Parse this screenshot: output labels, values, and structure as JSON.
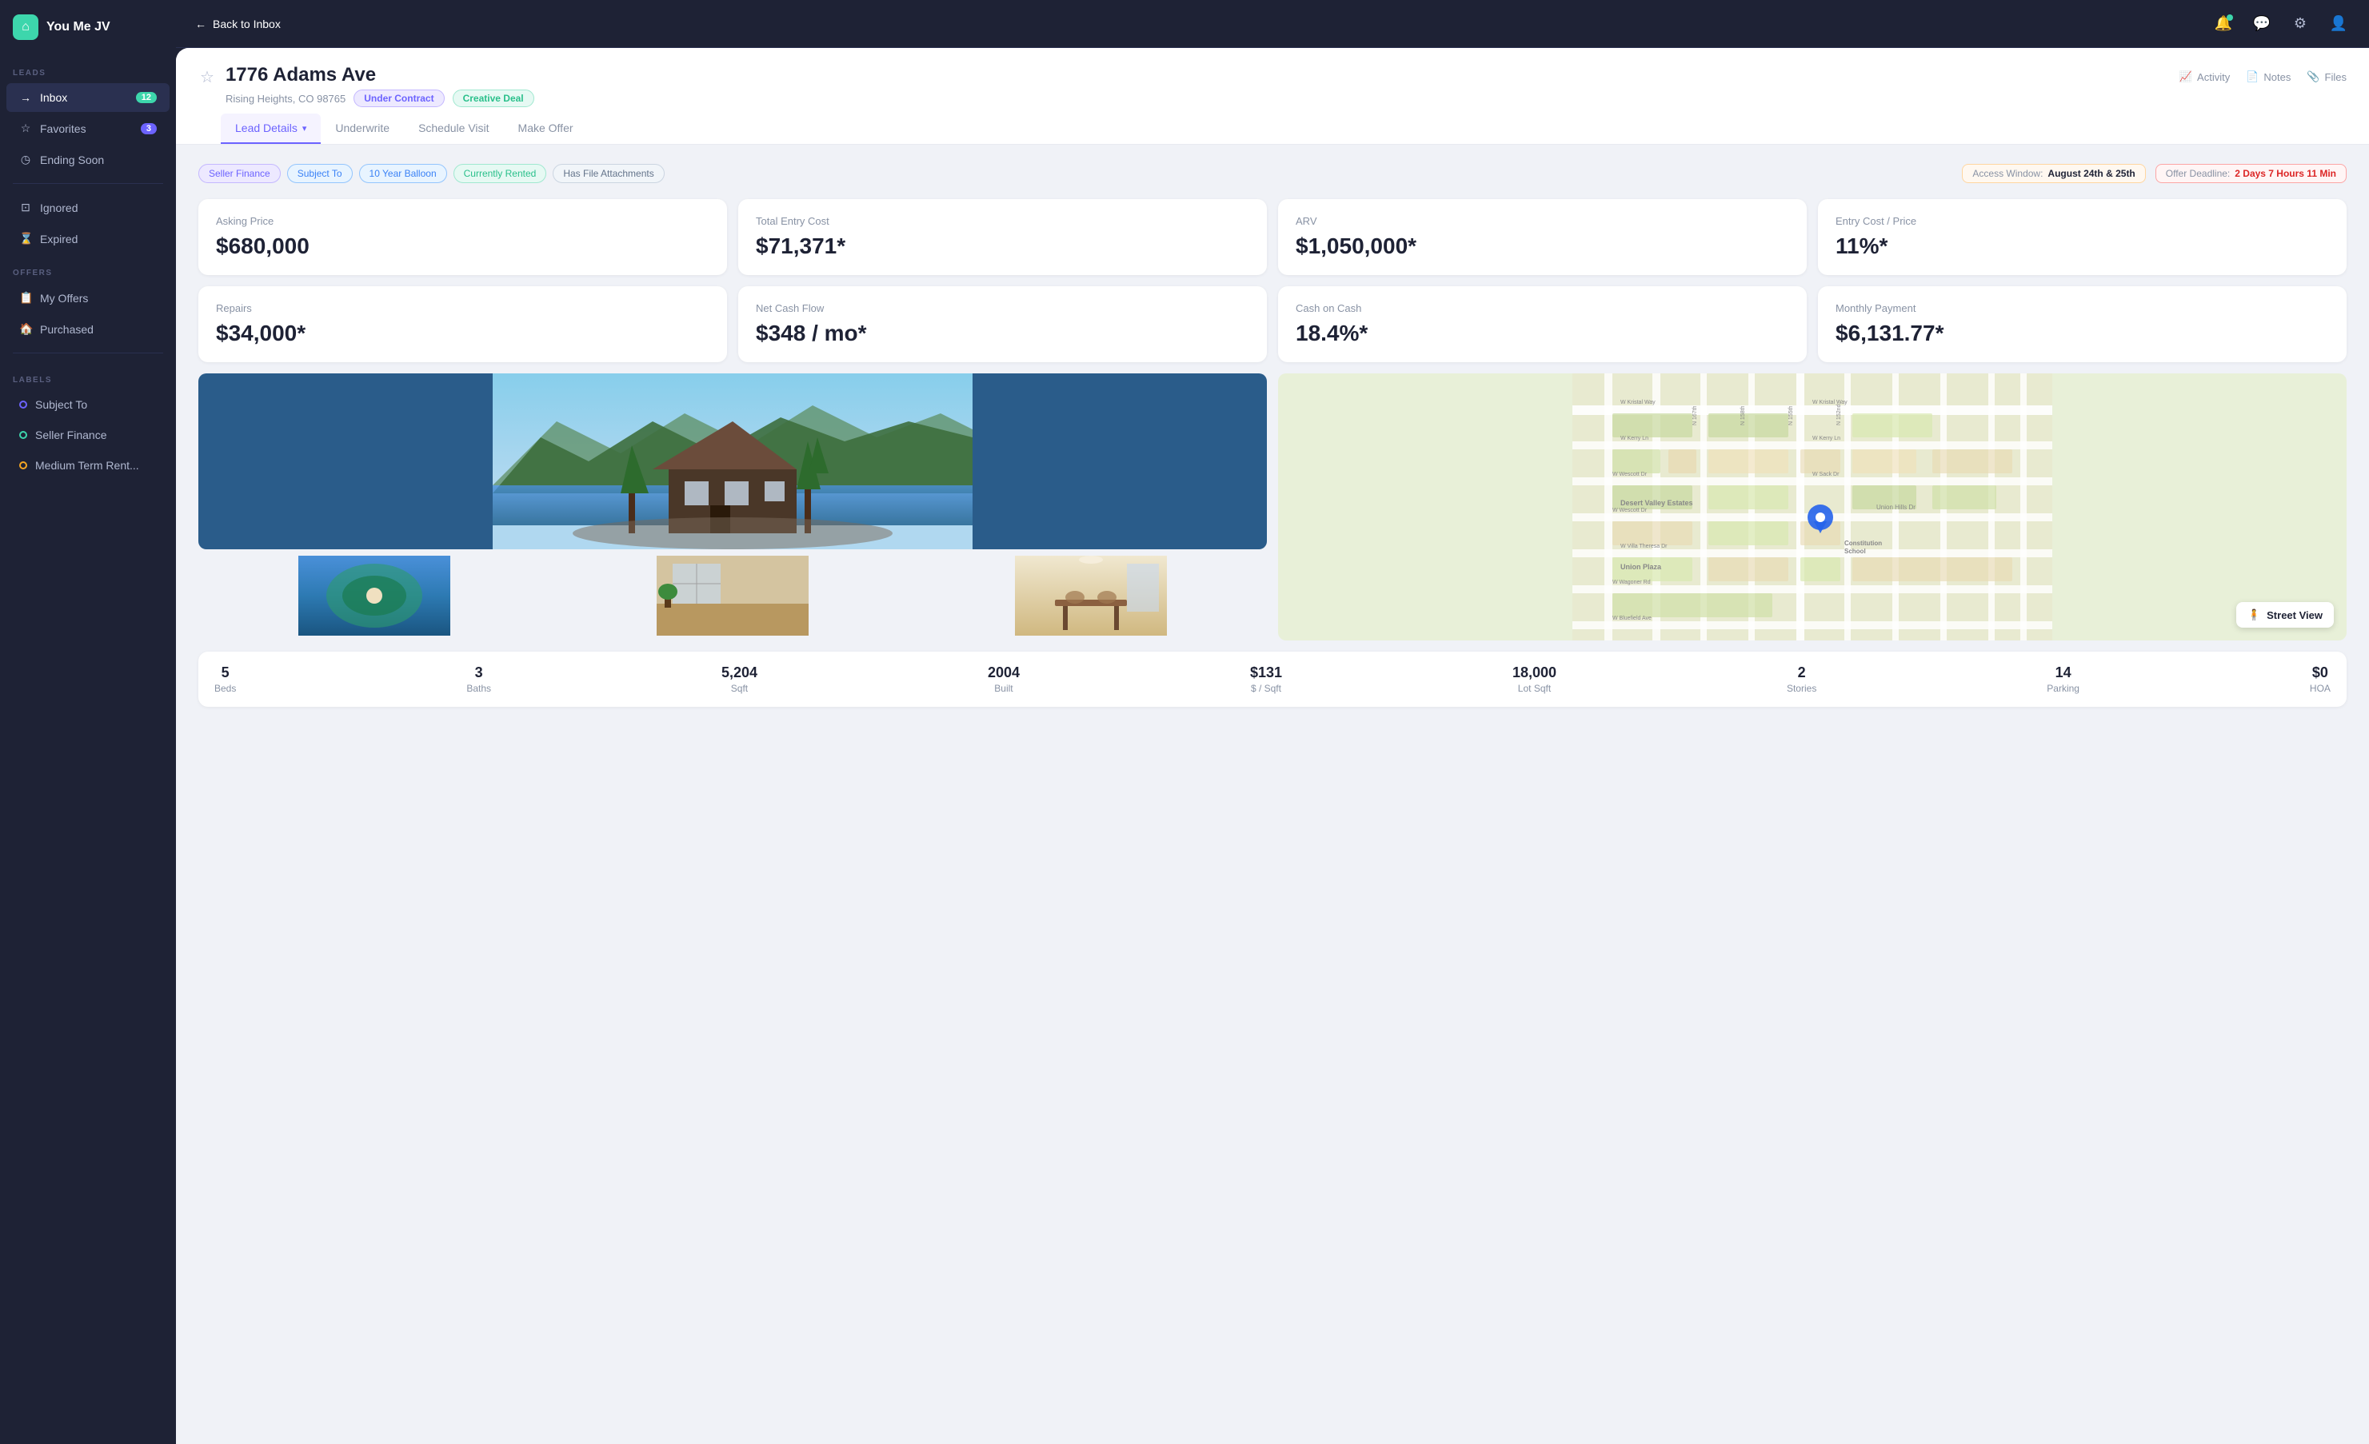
{
  "app": {
    "name": "You Me JV",
    "logo_letter": "⌂"
  },
  "sidebar": {
    "leads_label": "LEADS",
    "offers_label": "OFFERS",
    "labels_label": "LABELS",
    "items": [
      {
        "id": "inbox",
        "label": "Inbox",
        "icon": "→",
        "badge": "12",
        "active": true
      },
      {
        "id": "favorites",
        "label": "Favorites",
        "icon": "☆",
        "badge": "3",
        "badge_type": "blue",
        "active": false
      },
      {
        "id": "ending-soon",
        "label": "Ending Soon",
        "icon": "◷",
        "active": false
      }
    ],
    "ignored_label": "Ignored",
    "expired_label": "Expired",
    "my_offers_label": "My Offers",
    "purchased_label": "Purchased",
    "label_items": [
      {
        "label": "Subject To",
        "color": "purple"
      },
      {
        "label": "Seller Finance",
        "color": "teal"
      },
      {
        "label": "Medium Term Rent...",
        "color": "orange"
      }
    ]
  },
  "topbar": {
    "back_label": "Back to Inbox"
  },
  "property": {
    "address": "1776 Adams Ave",
    "location": "Rising Heights, CO 98765",
    "status": "Under Contract",
    "deal_type": "Creative Deal",
    "tags": [
      "Seller Finance",
      "Subject To",
      "10 Year Balloon",
      "Currently Rented",
      "Has File Attachments"
    ],
    "access_window_label": "Access Window:",
    "access_window_value": "August 24th & 25th",
    "offer_deadline_label": "Offer Deadline:",
    "offer_deadline_value": "2 Days  7 Hours  11 Min"
  },
  "tabs": [
    {
      "id": "lead-details",
      "label": "Lead Details",
      "has_chevron": true,
      "active": true
    },
    {
      "id": "underwrite",
      "label": "Underwrite",
      "active": false
    },
    {
      "id": "schedule-visit",
      "label": "Schedule Visit",
      "active": false
    },
    {
      "id": "make-offer",
      "label": "Make Offer",
      "active": false
    }
  ],
  "action_buttons": [
    {
      "id": "activity",
      "label": "Activity",
      "icon": "📈"
    },
    {
      "id": "notes",
      "label": "Notes",
      "icon": "📄"
    },
    {
      "id": "files",
      "label": "Files",
      "icon": "📎"
    }
  ],
  "stats": [
    {
      "label": "Asking Price",
      "value": "$680,000"
    },
    {
      "label": "Total Entry Cost",
      "value": "$71,371*"
    },
    {
      "label": "ARV",
      "value": "$1,050,000*"
    },
    {
      "label": "Entry Cost / Price",
      "value": "11%*"
    }
  ],
  "stats2": [
    {
      "label": "Repairs",
      "value": "$34,000*"
    },
    {
      "label": "Net Cash Flow",
      "value": "$348 / mo*"
    },
    {
      "label": "Cash on Cash",
      "value": "18.4%*"
    },
    {
      "label": "Monthly Payment",
      "value": "$6,131.77*"
    }
  ],
  "prop_stats": [
    {
      "value": "5",
      "label": "Beds"
    },
    {
      "value": "3",
      "label": "Baths"
    },
    {
      "value": "5,204",
      "label": "Sqft"
    },
    {
      "value": "2004",
      "label": "Built"
    },
    {
      "value": "$131",
      "label": "$ / Sqft"
    },
    {
      "value": "18,000",
      "label": "Lot Sqft"
    },
    {
      "value": "2",
      "label": "Stories"
    },
    {
      "value": "14",
      "label": "Parking"
    },
    {
      "value": "$0",
      "label": "HOA"
    }
  ],
  "map": {
    "street_view_label": "Street View"
  }
}
